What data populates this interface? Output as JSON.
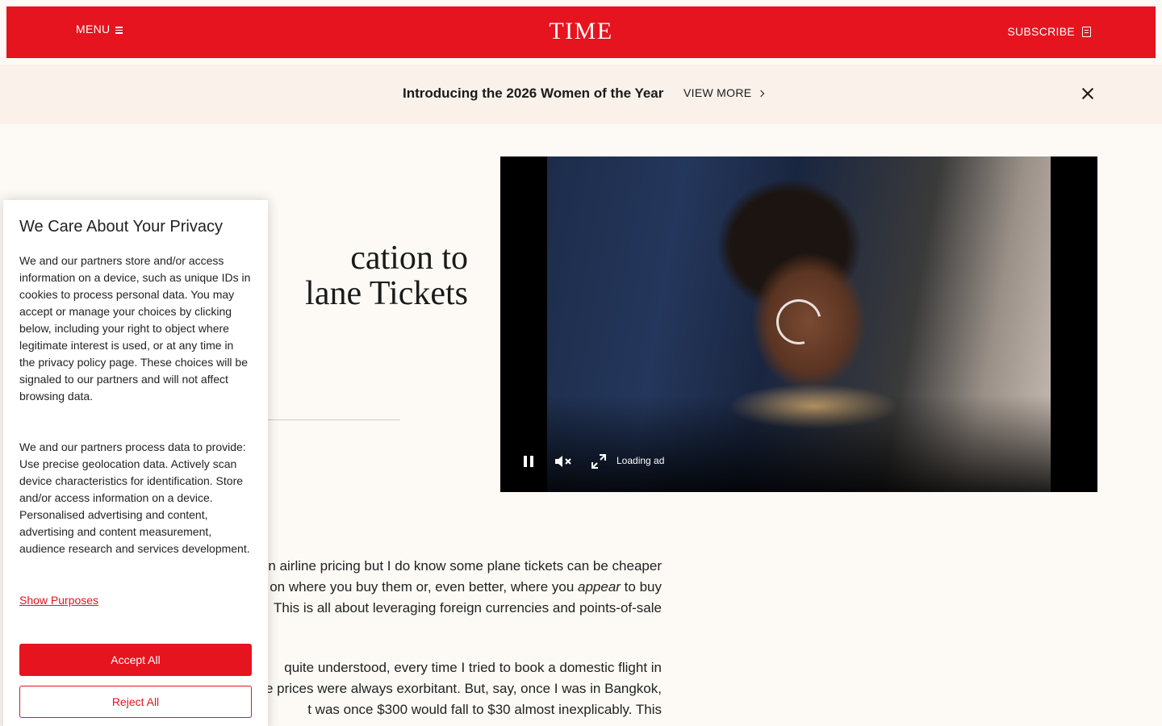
{
  "header": {
    "menu_label": "MENU",
    "logo": "TIME",
    "subscribe_label": "SUBSCRIBE",
    "background_color": "#e5141f"
  },
  "promo": {
    "title": "Introducing the 2026 Women of the Year",
    "link_label": "VIEW MORE"
  },
  "article": {
    "headline_line1": "cation to",
    "headline_line2": "lane Tickets",
    "paragraph1": {
      "line1": "n airline pricing but I do know some plane tickets can be cheaper",
      "line2_before": "on where you buy them or, even better, where you ",
      "line2_emphasis": "appear",
      "line2_after": " to buy",
      "line3": "This is all about leveraging foreign currencies and points-of-sale"
    },
    "paragraph2": {
      "line1": "quite understood, every time I tried to book a domestic flight in",
      "line2": "he prices were always exorbitant. But, say, once I was in Bangkok,",
      "line3": "t was once $300 would fall to $30 almost inexplicably. This"
    }
  },
  "video": {
    "status_text": "Loading ad",
    "controls": [
      "pause-icon",
      "mute-icon",
      "fullscreen-icon"
    ]
  },
  "privacy": {
    "title": "We Care About Your Privacy",
    "text1": "We and our partners store and/or access information on a device, such as unique IDs in cookies to process personal data. You may accept or manage your choices by clicking below, including your right to object where legitimate interest is used, or at any time in the privacy policy page. These choices will be signaled to our partners and will not affect browsing data.",
    "text2": "We and our partners process data to provide: Use precise geolocation data. Actively scan device characteristics for identification. Store and/or access information on a device. Personalised advertising and content, advertising and content measurement, audience research and services development.",
    "show_purposes": "Show Purposes",
    "accept_label": "Accept All",
    "reject_label": "Reject All",
    "accent_color": "#e5141f"
  }
}
